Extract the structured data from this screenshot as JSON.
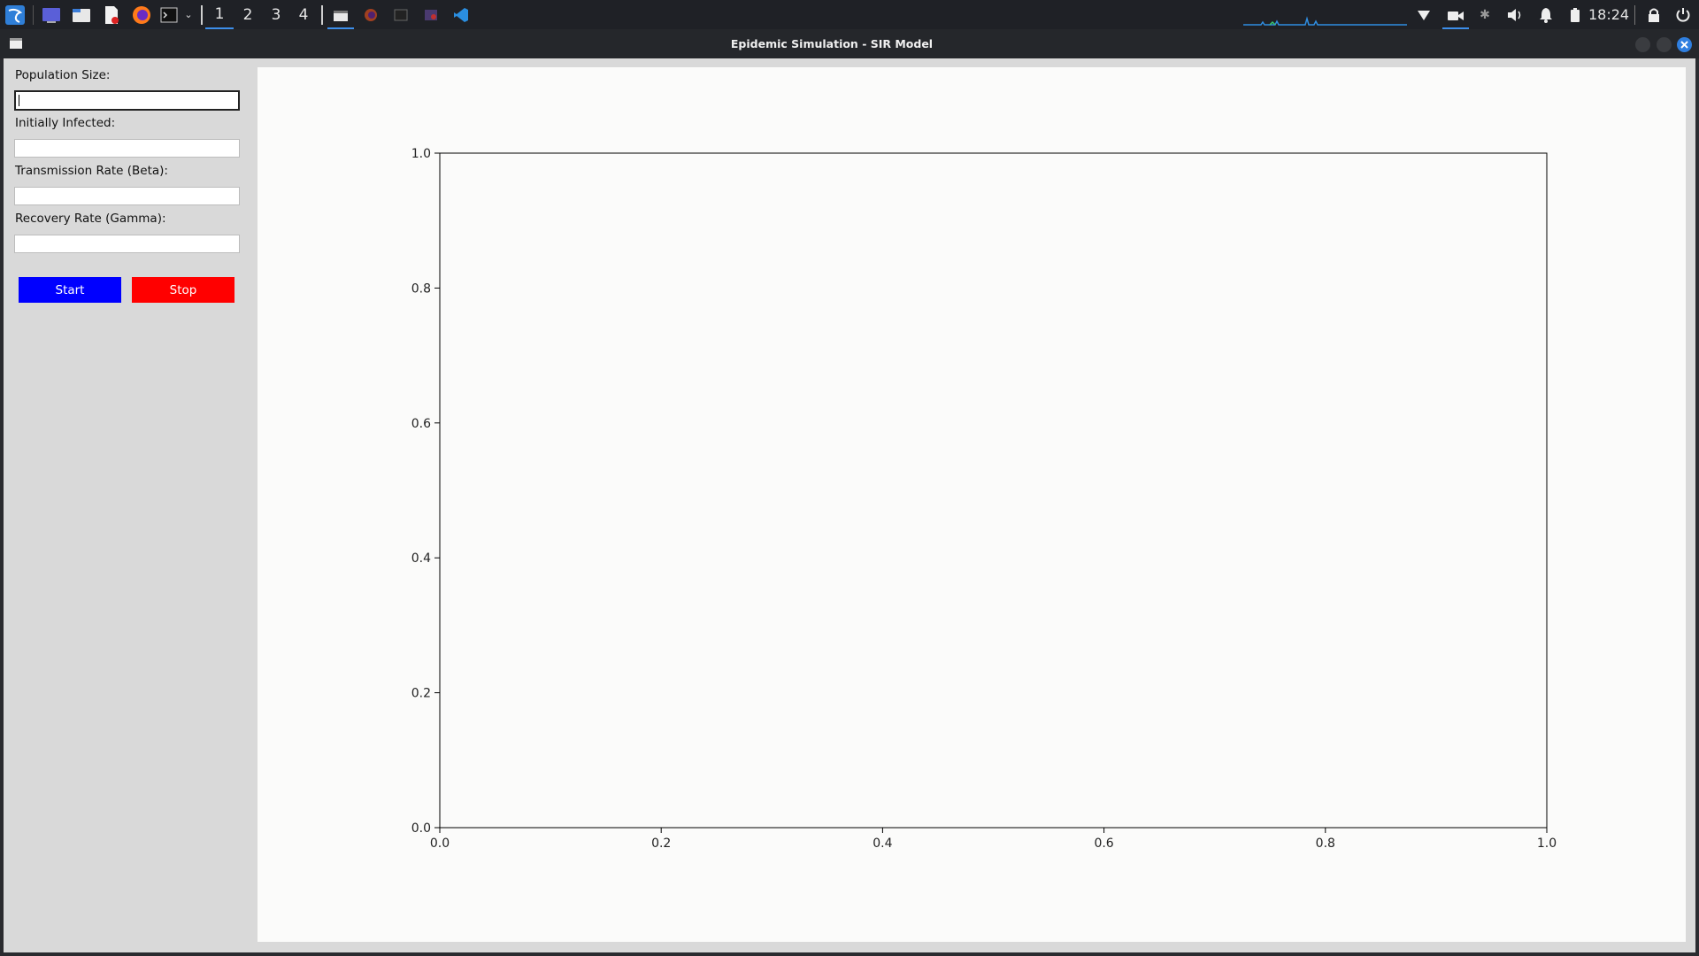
{
  "taskbar": {
    "workspaces": [
      "1",
      "2",
      "3",
      "4"
    ],
    "active_workspace": "1",
    "clock": "18:24",
    "icons": [
      "kali-menu-icon",
      "desktop-icon",
      "file-manager-icon",
      "text-editor-icon",
      "firefox-icon",
      "terminal-icon",
      "dropdown-icon",
      "window-icon",
      "firefox-window-icon",
      "terminal-window-icon",
      "app-window-icon",
      "vscode-icon",
      "network-icon",
      "camera-icon",
      "bluetooth-icon",
      "volume-icon",
      "bell-icon",
      "battery-icon",
      "lock-icon",
      "power-icon"
    ]
  },
  "window": {
    "title": "Epidemic Simulation - SIR Model"
  },
  "form": {
    "fields": [
      {
        "label": "Population Size:",
        "value": ""
      },
      {
        "label": "Initially Infected:",
        "value": ""
      },
      {
        "label": "Transmission Rate (Beta):",
        "value": ""
      },
      {
        "label": "Recovery Rate (Gamma):",
        "value": ""
      }
    ],
    "start_label": "Start",
    "stop_label": "Stop",
    "start_color": "#0000ff",
    "stop_color": "#ff0000"
  },
  "chart_data": {
    "type": "line",
    "series": [],
    "xlim": [
      0.0,
      1.0
    ],
    "ylim": [
      0.0,
      1.0
    ],
    "xticks": [
      "0.0",
      "0.2",
      "0.4",
      "0.6",
      "0.8",
      "1.0"
    ],
    "yticks": [
      "0.0",
      "0.2",
      "0.4",
      "0.6",
      "0.8",
      "1.0"
    ],
    "title": "",
    "xlabel": "",
    "ylabel": "",
    "grid": false
  }
}
